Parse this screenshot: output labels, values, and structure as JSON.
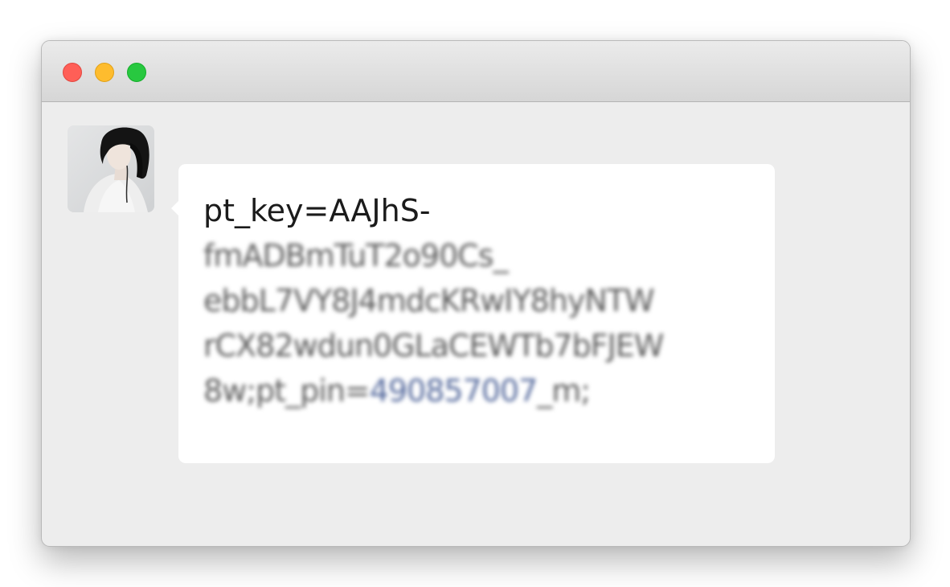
{
  "window": {
    "controls": {
      "close": "close",
      "minimize": "minimize",
      "maximize": "maximize"
    }
  },
  "chat": {
    "avatar_icon": "user-avatar-photo",
    "message": {
      "line1": "pt_key=AAJhS-",
      "line2": "fmADBmTuT2o90Cs_",
      "line3": "ebbL7VY8J4mdcKRwIY8hyNTW",
      "line4": "rCX82wdun0GLaCEWTb7bFJEW",
      "line5_prefix": "8w;pt_pin=",
      "line5_link": "490857007",
      "line5_suffix": "_m;"
    },
    "colors": {
      "bubble": "#ffffff",
      "background": "#ededed",
      "link": "#52679b",
      "text": "#1b1b1b"
    }
  }
}
